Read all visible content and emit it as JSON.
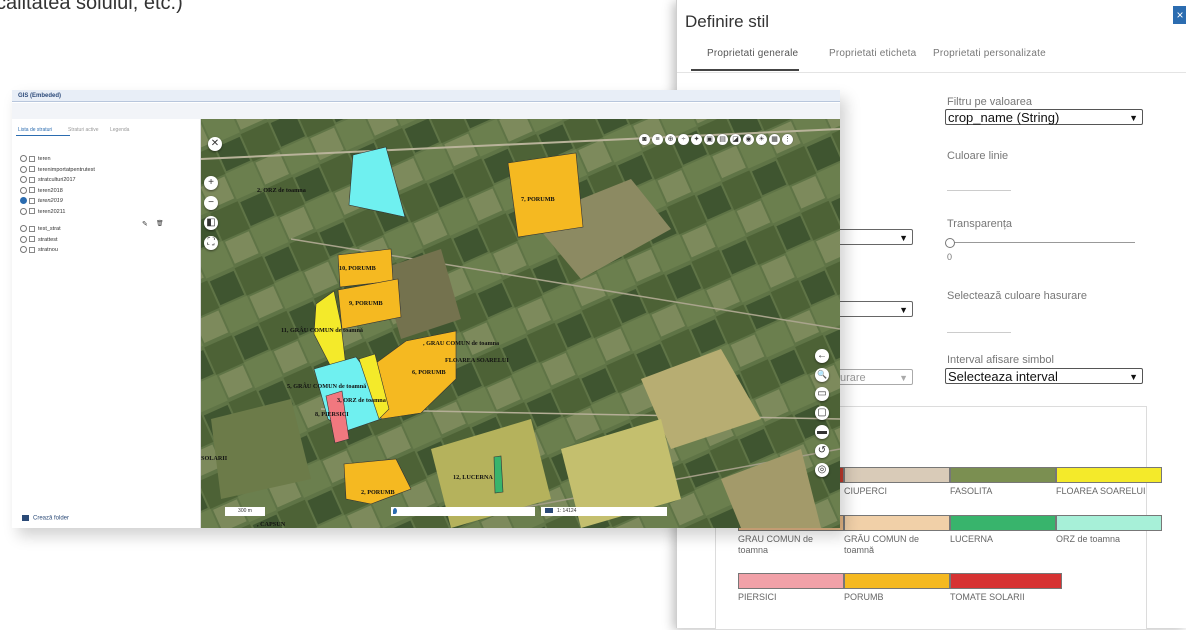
{
  "intro_text": "calitatea solului, etc.)",
  "dialog": {
    "title": "Definire stil",
    "close_symbol": "×",
    "tabs": [
      "Proprietati generale",
      "Proprietati eticheta",
      "Proprietati personalizate"
    ],
    "active_tab": "Proprietati generale",
    "filter_label": "Filtru pe valoarea",
    "filter_value": "crop_name (String)",
    "line_color_label": "Culoare linie",
    "transparency_label": "Transparența",
    "transparency_value": "0",
    "hatch_color_label": "Selectează culoare hasurare",
    "partial_hatch_text": "urare",
    "symbol_interval_label": "Interval afisare simbol",
    "symbol_interval_value": "Selecteaza interval",
    "legend": [
      {
        "label": "",
        "color": "#c0392b"
      },
      {
        "label": "CIUPERCI",
        "color": "#d9cbb8"
      },
      {
        "label": "FASOLITA",
        "color": "#7b8f51"
      },
      {
        "label": "FLOAREA SOARELUI",
        "color": "#f4ea2a"
      },
      {
        "label": "GRAU COMUN de toamna",
        "color": "#e6b886"
      },
      {
        "label": "GRÂU COMUN de toamnă",
        "color": "#f1d0a8"
      },
      {
        "label": "LUCERNA",
        "color": "#38b46c"
      },
      {
        "label": "ORZ de toamna",
        "color": "#a7f0d8"
      },
      {
        "label": "PIERSICI",
        "color": "#f1a1a8"
      },
      {
        "label": "PORUMB",
        "color": "#f5b921"
      },
      {
        "label": "TOMATE SOLARII",
        "color": "#d63232"
      }
    ]
  },
  "gis": {
    "title": "GIS (Embeded)",
    "side_tabs": [
      "Lista de straturi",
      "Straturi active",
      "Legenda"
    ],
    "layers": [
      {
        "name": "teren",
        "checked": false
      },
      {
        "name": "terenimportatpentrutest",
        "checked": false
      },
      {
        "name": "stratculturi2017",
        "checked": false
      },
      {
        "name": "teren2018",
        "checked": false
      },
      {
        "name": "teren2019",
        "checked": true
      },
      {
        "name": "teren20211",
        "checked": false
      },
      {
        "name": "test_strat",
        "checked": false
      },
      {
        "name": "strattest",
        "checked": false
      },
      {
        "name": "stratnou",
        "checked": false
      }
    ],
    "edit_icon": "✎",
    "delete_icon": "🗑",
    "create_folder": "Crează folder",
    "map": {
      "parcel_labels": [
        "2, ORZ de toamna",
        "7, PORUMB",
        "10, PORUMB",
        "9, PORUMB",
        "11, GRÂU COMUN de toamnă",
        ", GRAU COMUN de toamna",
        "FLOAREA SOARELUI",
        "6, PORUMB",
        "5, GRÂU COMUN de toamnă",
        "3, ORZ de toamna",
        "8, PIERSICI",
        "2, PORUMB",
        "12, LUCERNA",
        "SOLARII",
        ", CAPSUN"
      ],
      "scale_text": "300 m",
      "scale_ratio": "1: 14124",
      "controls": {
        "close": "✕",
        "zoom_in": "+",
        "zoom_out": "−",
        "pan": "◧",
        "fullscreen": "⛶",
        "back": "←",
        "search": "🔍"
      }
    }
  }
}
